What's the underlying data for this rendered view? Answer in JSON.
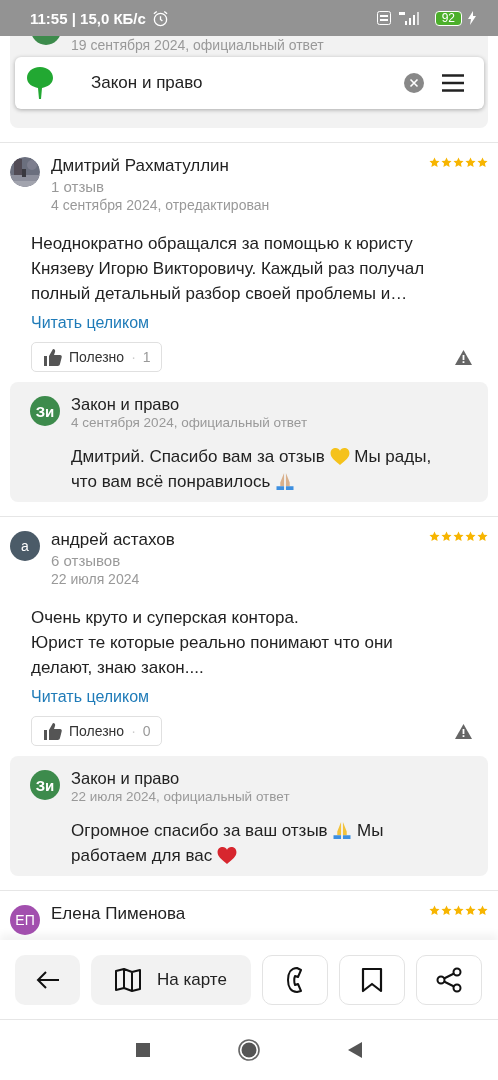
{
  "status_bar": {
    "time": "11:55 | 15,0 КБ/с",
    "battery": "92"
  },
  "search": {
    "value": "Закон и право"
  },
  "previous_reply": {
    "date": "19 сентября 2024, официальный ответ"
  },
  "reviews": [
    {
      "author": "Дмитрий Рахматуллин",
      "count": "1 отзыв",
      "date": "4 сентября 2024, отредактирован",
      "stars": 5,
      "text": "Неоднократно обращался за помощью к юристу Князеву Игорю Викторовичу. Каждый раз получал полный детальный разбор своей проблемы и…",
      "link": "Читать целиком",
      "useful": {
        "label": "Полезно",
        "separator": "·",
        "count": "1"
      },
      "reply": {
        "avatar_text": "Зи",
        "name": "Закон и право",
        "date": "4 сентября 2024, официальный ответ",
        "parts": [
          {
            "kind": "text",
            "text": "Дмитрий. Спасибо вам за отзыв "
          },
          {
            "kind": "heart",
            "color": "#f5c21b"
          },
          {
            "kind": "text",
            "text": " Мы рады, что вам всё понравилось "
          },
          {
            "kind": "hands",
            "color": "#d9b08c"
          }
        ]
      }
    },
    {
      "author": "андрей астахов",
      "avatar": {
        "kind": "letter",
        "text": "а",
        "color": "#4b5b68"
      },
      "count": "6 отзывов",
      "date": "22 июля 2024",
      "stars": 5,
      "text": "Очень круто и суперская контора.\nЮрист те которые реально понимают что они делают, знаю закон....",
      "link": "Читать целиком",
      "useful": {
        "label": "Полезно",
        "separator": "·",
        "count": "0"
      },
      "reply": {
        "avatar_text": "Зи",
        "name": "Закон и право",
        "date": "22 июля 2024, официальный ответ",
        "parts": [
          {
            "kind": "text",
            "text": "Огромное спасибо за ваш отзыв "
          },
          {
            "kind": "hands",
            "color": "#f2c23a"
          },
          {
            "kind": "text",
            "text": " Мы работаем для вас "
          },
          {
            "kind": "heart",
            "color": "#d7262e"
          }
        ]
      }
    },
    {
      "author": "Елена Пименова",
      "avatar": {
        "kind": "letter",
        "text": "ЕП",
        "color": "#a24fae"
      },
      "stars": 5
    }
  ],
  "bottom_bar": {
    "map_label": "На карте"
  }
}
